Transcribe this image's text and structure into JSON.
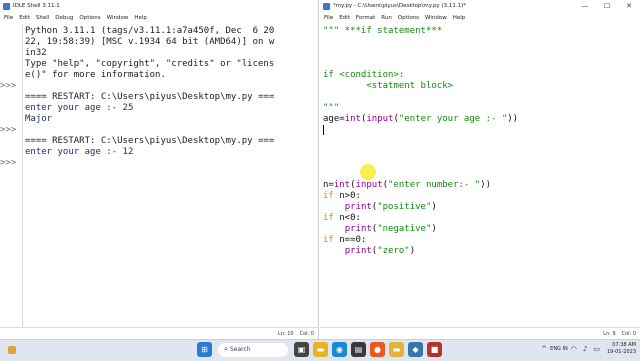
{
  "shell": {
    "title": "IDLE Shell 3.11.1",
    "menu": [
      "File",
      "Edit",
      "Shell",
      "Debug",
      "Options",
      "Window",
      "Help"
    ],
    "prompts": [
      ">>>",
      ">>>",
      ">>>"
    ],
    "lines": [
      "Python 3.11.1 (tags/v3.11.1:a7a450f, Dec  6 20",
      "22, 19:58:39) [MSC v.1934 64 bit (AMD64)] on w",
      "in32",
      "Type \"help\", \"copyright\", \"credits\" or \"licens",
      "e()\" for more information.",
      "",
      "==== RESTART: C:\\Users\\piyus\\Desktop\\my.py ===",
      "enter your age :- 25",
      "Major",
      "",
      "==== RESTART: C:\\Users\\piyus\\Desktop\\my.py ===",
      "enter your age :- 12"
    ],
    "status": {
      "ln": "Ln: 10",
      "col": "Col: 0"
    }
  },
  "editor": {
    "title": "*my.py - C:\\Users\\piyus\\Desktop\\my.py (3.11.1)*",
    "menu": [
      "File",
      "Edit",
      "Format",
      "Run",
      "Options",
      "Window",
      "Help"
    ],
    "status": {
      "ln": "Ln: 9",
      "col": "Col: 0"
    }
  },
  "window_controls": {
    "minimize": "—",
    "maximize": "☐",
    "close": "✕"
  },
  "taskbar": {
    "search_label": "Search",
    "clock_time": "07:38 AM",
    "clock_date": "19-01-2023",
    "lang": "ENG IN"
  },
  "colors": {
    "string": "#118a0d",
    "keyword": "#ff7a00",
    "builtin": "#900090",
    "output": "#1f2d73"
  }
}
